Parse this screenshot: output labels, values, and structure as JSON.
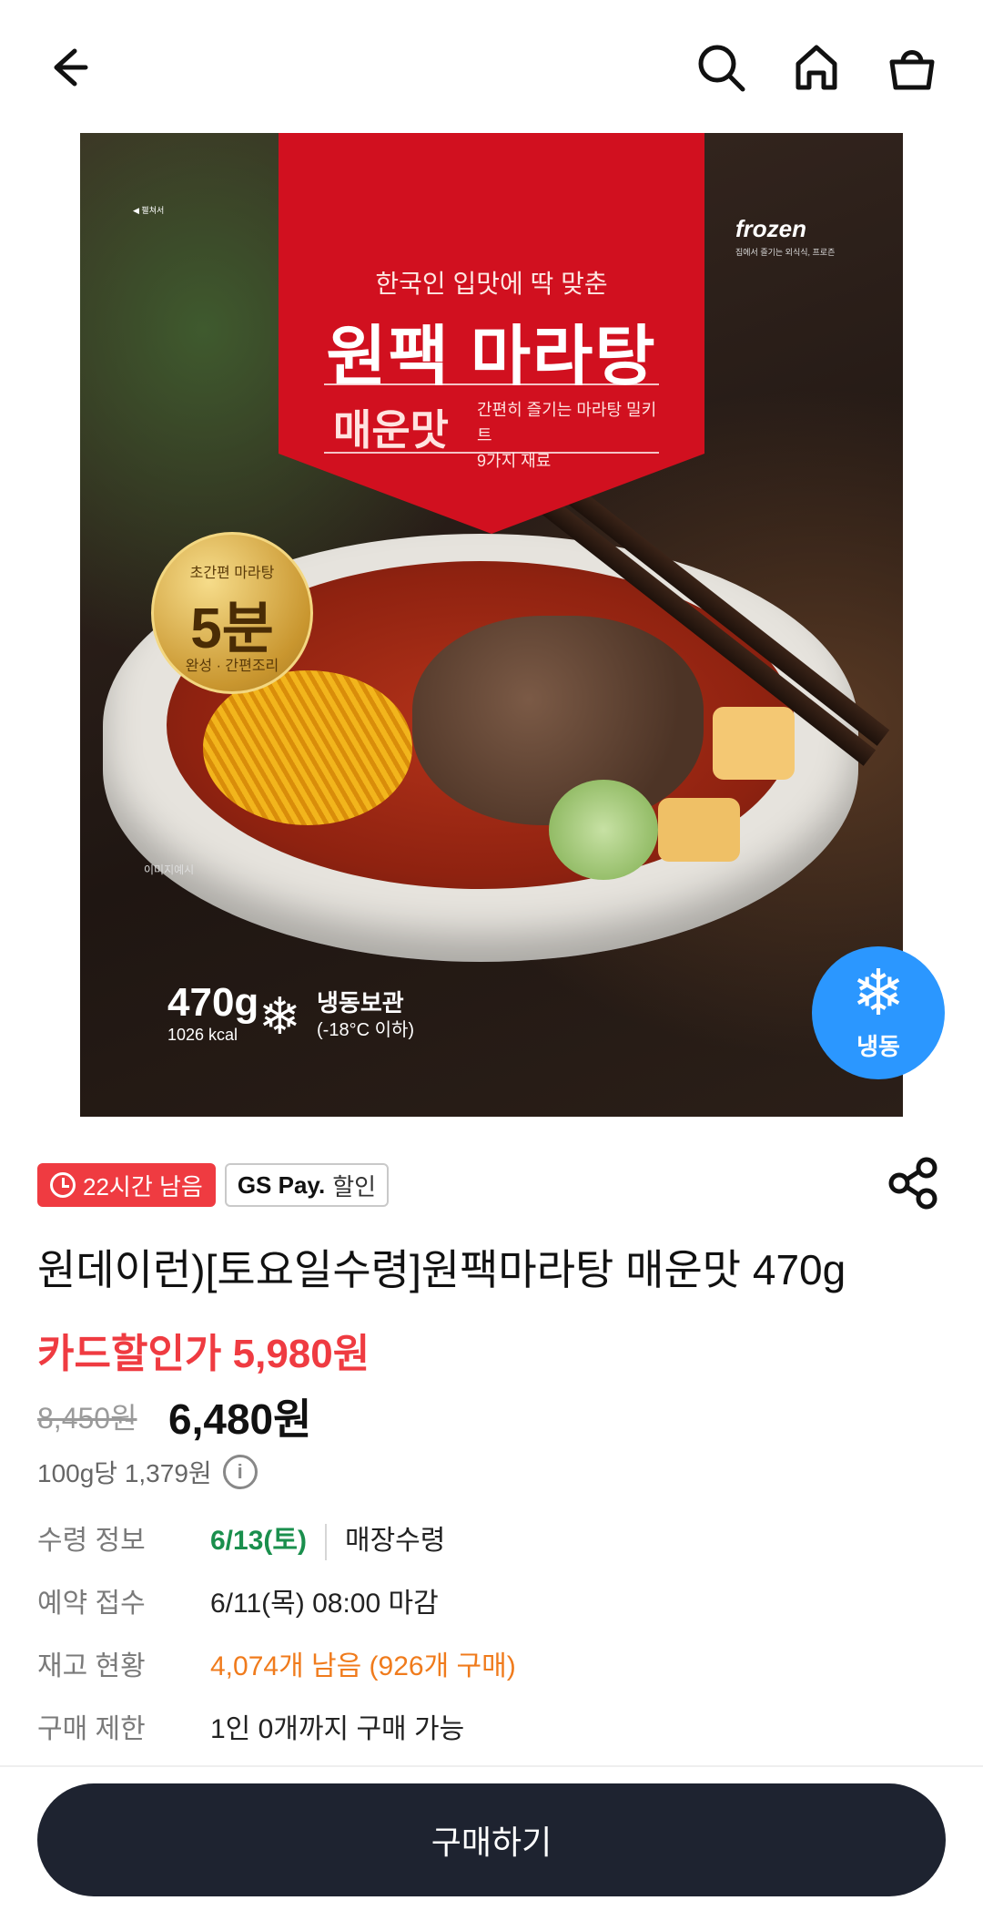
{
  "header": {
    "icons": [
      "back-arrow-icon",
      "search-icon",
      "home-icon",
      "shopping-bag-icon"
    ]
  },
  "hero": {
    "pack_subtitle": "한국인 입맛에 딱 맞춘",
    "pack_title": "원팩 마라탕",
    "pack_flavor": "매운맛",
    "pack_desc1": "간편히 즐기는 마라탕 밀키트",
    "pack_desc2": "9가지 재료",
    "brand_logo": "frozen",
    "brand_tagline": "집에서 즐기는 외식식, 프로즌",
    "top_small": "◀ 펼쳐서",
    "gold_badge_top": "초간편 마라탕",
    "gold_badge_main": "5분",
    "gold_badge_sub": "완성",
    "gold_badge_bottom": "간편조리",
    "weight": "470g",
    "kcal": "1026 kcal",
    "storage_line1": "냉동보관",
    "storage_line2": "(-18°C 이하)",
    "sample_note": "이미지예시",
    "frozen_badge_label": "냉동"
  },
  "tags": {
    "time_left": "22시간 남음",
    "pay_brand": "GS Pay.",
    "pay_label": "할인"
  },
  "product": {
    "title": "원데이런)[토요일수령]원팩마라탕 매운맛 470g",
    "card_price": "카드할인가 5,980원",
    "original_price": "8,450원",
    "sale_price": "6,480원",
    "unit_price": "100g당 1,379원"
  },
  "info": {
    "pickup_label": "수령 정보",
    "pickup_date": "6/13(토)",
    "pickup_method": "매장수령",
    "reserve_label": "예약 접수",
    "reserve_value": "6/11(목) 08:00 마감",
    "stock_label": "재고 현황",
    "stock_value": "4,074개 남음 (926개 구매)",
    "limit_label": "구매 제한",
    "limit_value": "1인 0개까지 구매 가능"
  },
  "bottom": {
    "buy_label": "구매하기"
  },
  "colors": {
    "discount_red": "#ef3b41",
    "pickup_green": "#1a8f4d",
    "stock_orange": "#f07b1c",
    "button_dark": "#1e2330",
    "frozen_blue": "#2b97ff"
  }
}
